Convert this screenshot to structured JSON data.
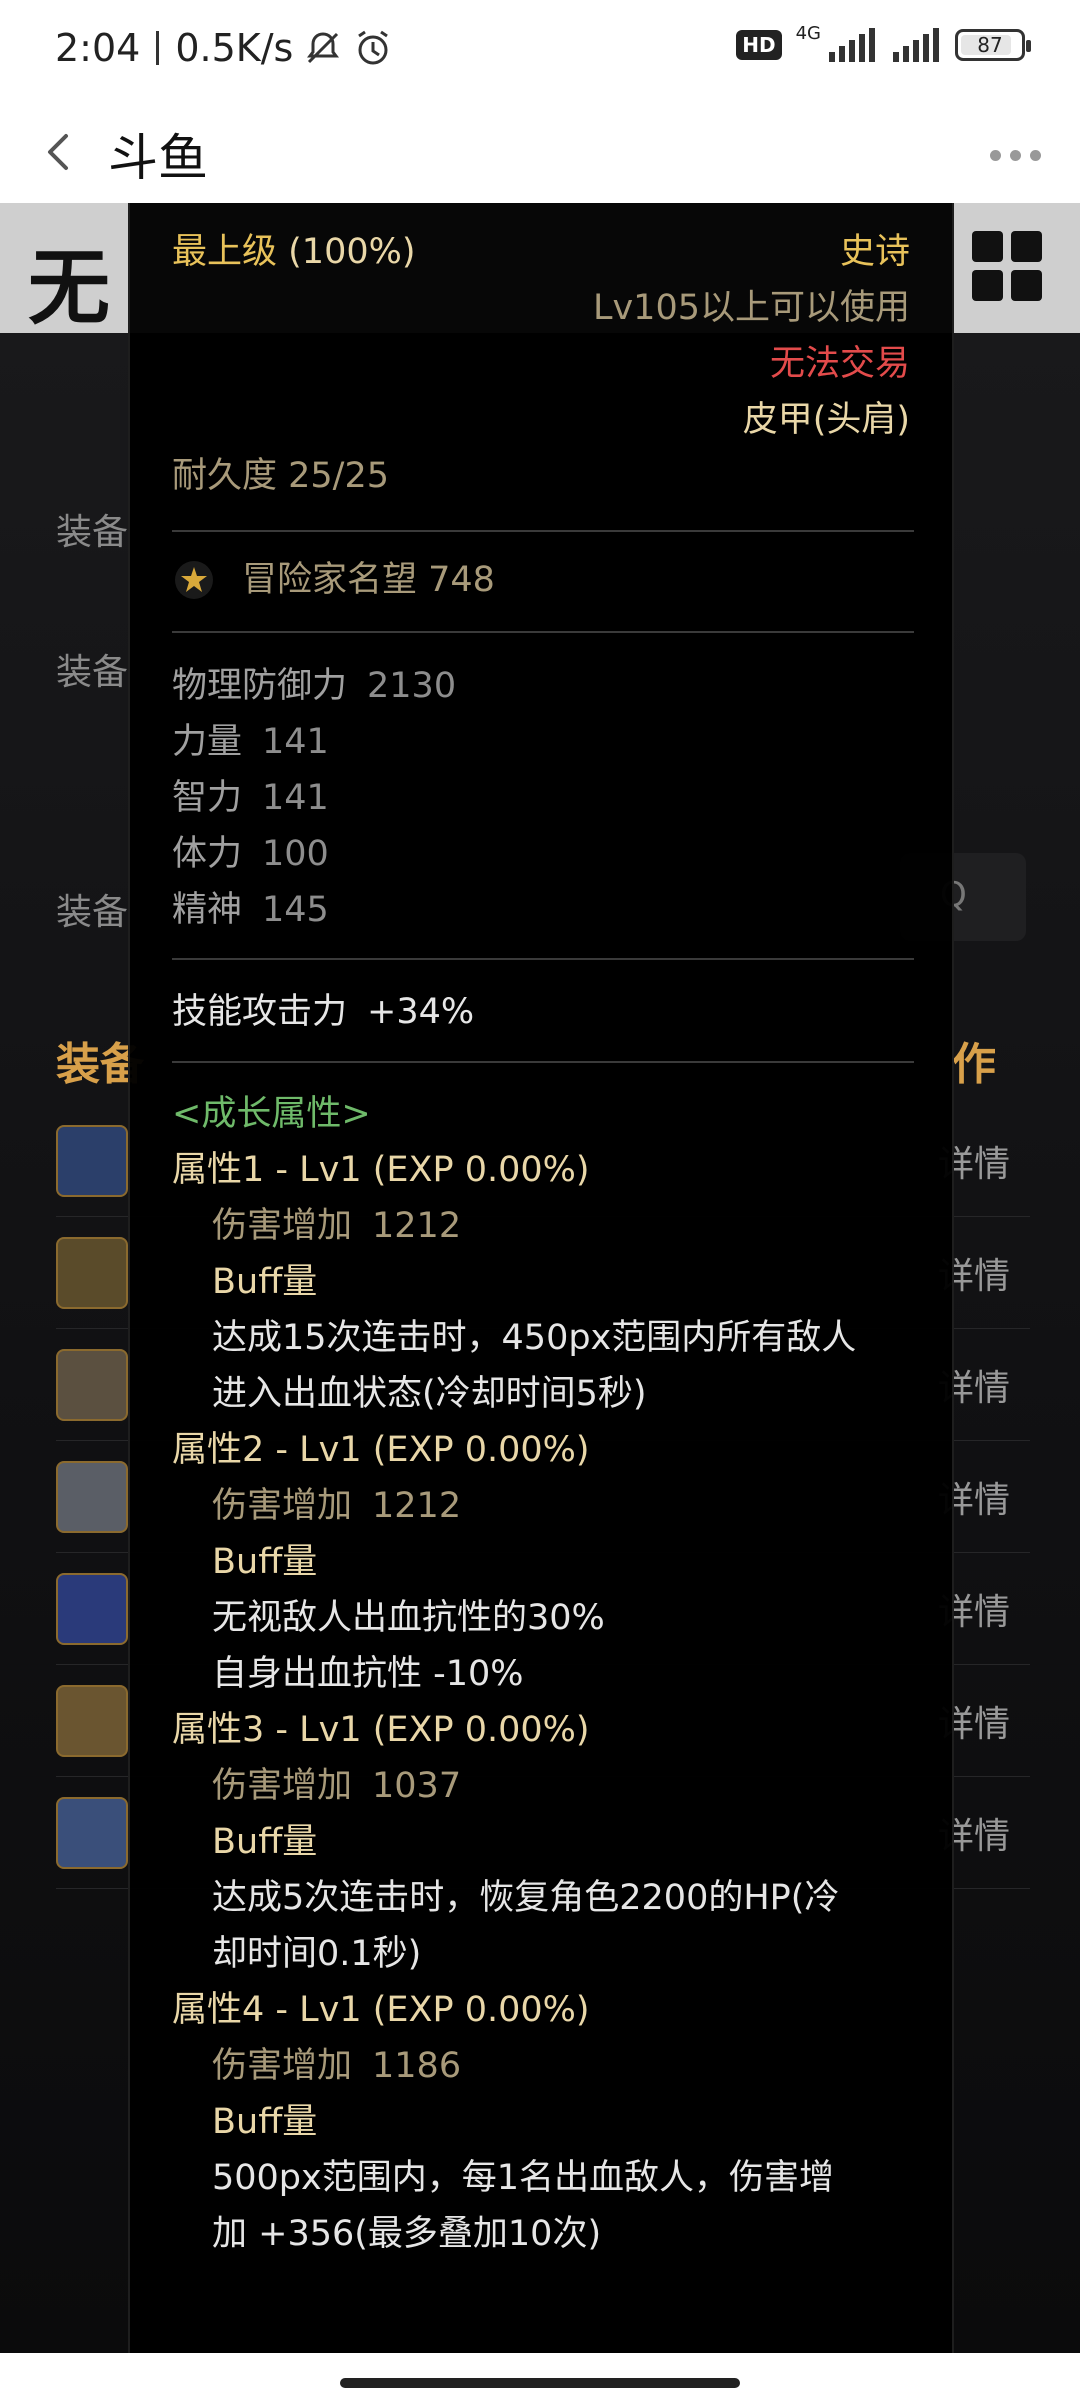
{
  "status_bar": {
    "time": "2:04",
    "net_speed": "0.5K/s",
    "hd_badge": "HD",
    "network_label": "4G",
    "battery": "87",
    "battery_level": 0.87,
    "icons": [
      "mute-bell-icon",
      "alarm-icon",
      "signal-icon",
      "battery-icon"
    ]
  },
  "header": {
    "title": "斗鱼",
    "icons": [
      "back-icon",
      "more-icon"
    ]
  },
  "background_page": {
    "logo": "无",
    "labels": [
      "装备",
      "装备",
      "装备"
    ],
    "section_left": "装备",
    "section_right": "作",
    "search_glyph": "Q",
    "row_detail_label": "详情",
    "row_count": 7
  },
  "tooltip": {
    "grade": "最上级",
    "grade_pct": "(100%)",
    "rarity": "史诗",
    "level_req": "Lv105以上可以使用",
    "trade": "无法交易",
    "item_type": "皮甲(头肩)",
    "durability": "耐久度 25/25",
    "fame": "冒险家名望 748",
    "stats": [
      {
        "label": "物理防御力",
        "value": "2130"
      },
      {
        "label": "力量",
        "value": "141"
      },
      {
        "label": "智力",
        "value": "141"
      },
      {
        "label": "体力",
        "value": "100"
      },
      {
        "label": "精神",
        "value": "145"
      }
    ],
    "skill_attack": {
      "label": "技能攻击力",
      "value": "+34%"
    },
    "growth_header": "<成长属性>",
    "growth": [
      {
        "title": "属性1 - Lv1 (EXP 0.00%)",
        "damage_label": "伤害增加",
        "damage_value": "1212",
        "buff_label": "Buff量",
        "effects": [
          "达成15次连击时，450px范围内所有敌人",
          "进入出血状态(冷却时间5秒)"
        ]
      },
      {
        "title": "属性2 - Lv1 (EXP 0.00%)",
        "damage_label": "伤害增加",
        "damage_value": "1212",
        "buff_label": "Buff量",
        "effects": [
          "无视敌人出血抗性的30%",
          "自身出血抗性 -10%"
        ]
      },
      {
        "title": "属性3 - Lv1 (EXP 0.00%)",
        "damage_label": "伤害增加",
        "damage_value": "1037",
        "buff_label": "Buff量",
        "effects": [
          "达成5次连击时，恢复角色2200的HP(冷",
          "却时间0.1秒)"
        ]
      },
      {
        "title": "属性4 - Lv1 (EXP 0.00%)",
        "damage_label": "伤害增加",
        "damage_value": "1186",
        "buff_label": "Buff量",
        "effects": [
          "500px范围内，每1名出血敌人，伤害增",
          "加 +356(最多叠加10次)"
        ]
      }
    ]
  },
  "colors": {
    "gold": "#e8c25a",
    "red": "#e34b4b",
    "green": "#6fba6a",
    "tan": "#a89a7a"
  }
}
